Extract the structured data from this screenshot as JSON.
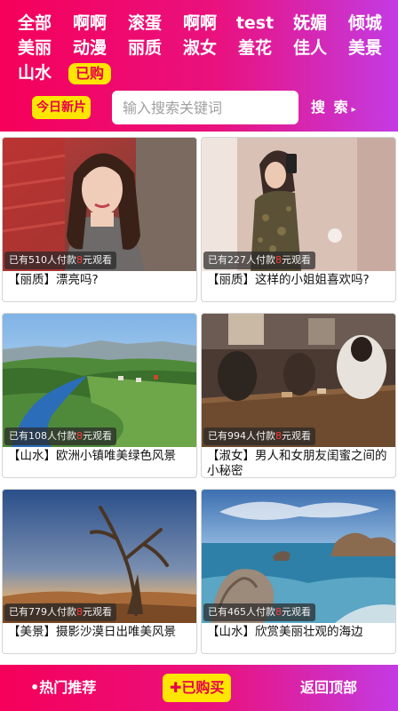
{
  "categories": [
    [
      {
        "label": "全部"
      },
      {
        "label": "啊啊"
      },
      {
        "label": "滚蛋"
      },
      {
        "label": "啊啊"
      },
      {
        "label": "test"
      },
      {
        "label": "妩媚"
      },
      {
        "label": "倾城"
      }
    ],
    [
      {
        "label": "美丽"
      },
      {
        "label": "动漫"
      },
      {
        "label": "丽质"
      },
      {
        "label": "淑女"
      },
      {
        "label": "羞花"
      },
      {
        "label": "佳人"
      },
      {
        "label": "美景"
      }
    ],
    [
      {
        "label": "山水"
      },
      {
        "label": "已购",
        "active": true
      }
    ]
  ],
  "search": {
    "today_label": "今日新片",
    "placeholder": "输入搜索关键词",
    "button_label": "搜 索",
    "button_arrow": "▸"
  },
  "overlay_text": {
    "prefix": "已有",
    "middle": "人付款",
    "price": "8",
    "suffix": "元观看"
  },
  "videos": [
    {
      "buyers": "510",
      "title": "【丽质】漂亮吗?"
    },
    {
      "buyers": "227",
      "title": "【丽质】这样的小姐姐喜欢吗?"
    },
    {
      "buyers": "108",
      "title": "【山水】欧洲小镇唯美绿色风景"
    },
    {
      "buyers": "994",
      "title": "【淑女】男人和女朋友闺蜜之间的小秘密"
    },
    {
      "buyers": "779",
      "title": "【美景】摄影沙漠日出唯美风景"
    },
    {
      "buyers": "465",
      "title": "【山水】欣赏美丽壮观的海边"
    }
  ],
  "bottom_bar": {
    "hot_label": "•热门推荐",
    "purchased_label": "✚已购买",
    "top_label": "返回顶部"
  },
  "colors": {
    "brand_gradient_start": "#f5005a",
    "brand_gradient_end": "#c33be3",
    "accent_yellow": "#ffe600",
    "accent_pink_text": "#e6004c",
    "price_red": "#ff3a3a"
  }
}
